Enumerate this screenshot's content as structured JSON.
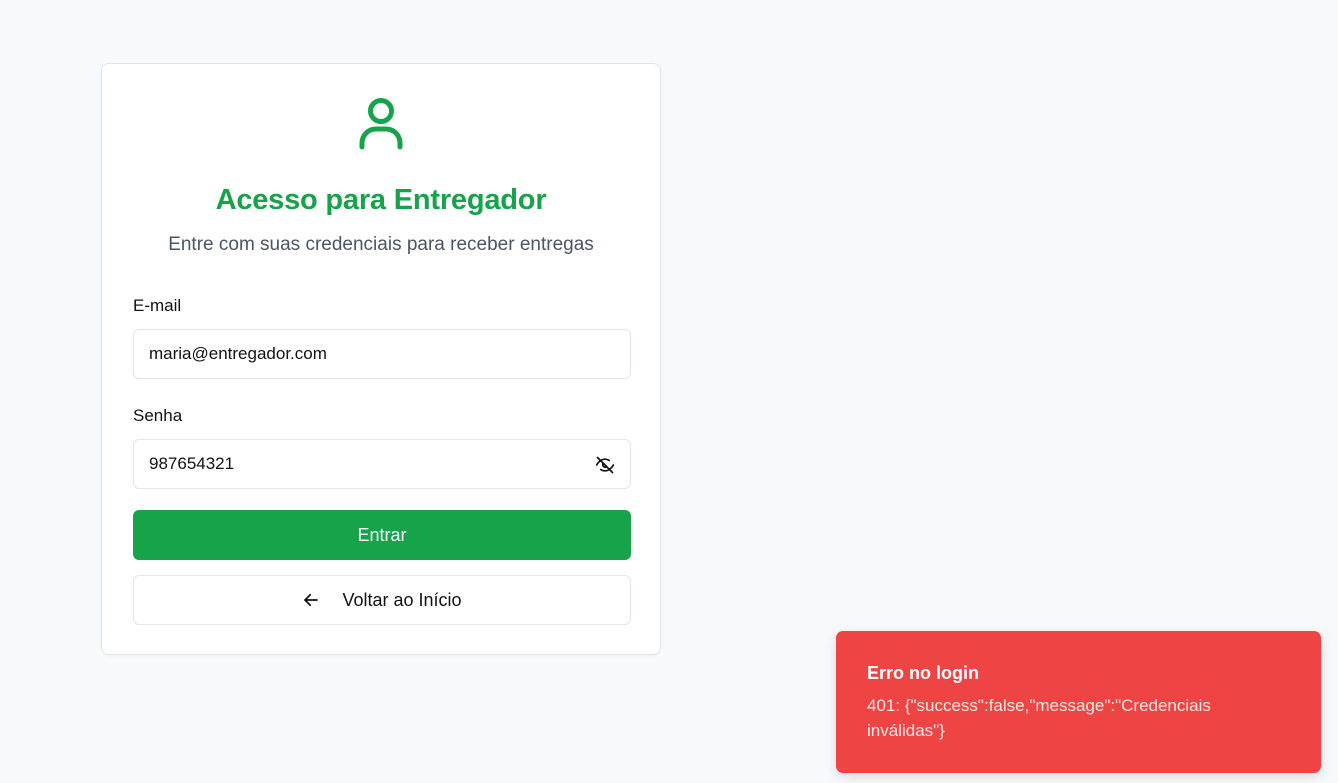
{
  "login_card": {
    "icon": "user-icon",
    "title": "Acesso para Entregador",
    "subtitle": "Entre com suas credenciais para receber entregas",
    "email": {
      "label": "E-mail",
      "value": "maria@entregador.com"
    },
    "password": {
      "label": "Senha",
      "value": "987654321",
      "toggle_icon": "eye-off-icon"
    },
    "submit_label": "Entrar",
    "back_label": "Voltar ao Início",
    "back_icon": "arrow-left-icon"
  },
  "toast": {
    "title": "Erro no login",
    "message": "401: {\"success\":false,\"message\":\"Credenciais inválidas\"}"
  },
  "colors": {
    "brand_green": "#16a34a",
    "error_red": "#ef4444",
    "background": "#f8f9fb"
  }
}
